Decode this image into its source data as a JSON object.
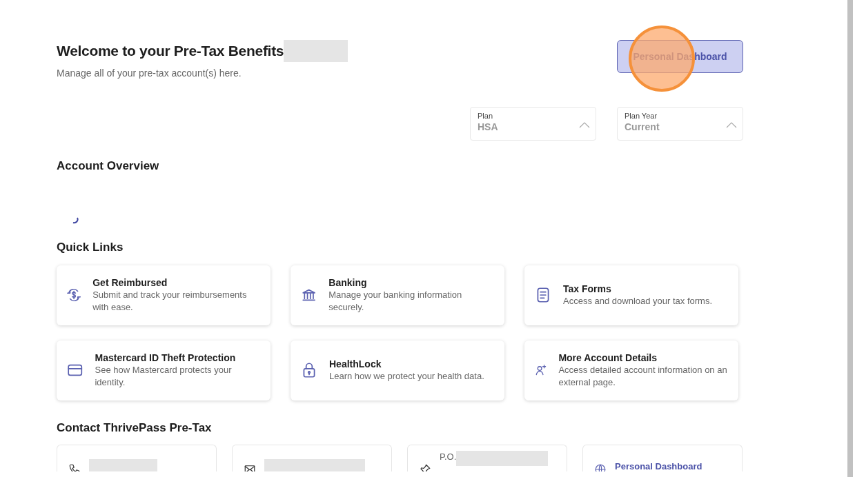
{
  "header": {
    "title": "Welcome to your Pre-Tax Benefits",
    "title_redacted": true,
    "subtitle": "Manage all of your pre-tax account(s) here.",
    "button": "Personal Dashboard",
    "click_marker": true
  },
  "filters": [
    {
      "label": "Plan",
      "value": "HSA",
      "expanded": true
    },
    {
      "label": "Plan Year",
      "value": "Current",
      "expanded": true
    }
  ],
  "account_overview": {
    "title": "Account Overview",
    "loading": true
  },
  "quick_links": {
    "title": "Quick Links",
    "items": [
      {
        "kind": "reimburse",
        "title": "Get Reimbursed",
        "description": "Submit and track your reimbursements with ease."
      },
      {
        "kind": "bank",
        "title": "Banking",
        "description": "Manage your banking information securely."
      },
      {
        "kind": "document",
        "title": "Tax Forms",
        "description": "Access and download your tax forms."
      },
      {
        "kind": "card",
        "title": "Mastercard ID Theft Protection",
        "description": "See how Mastercard protects your identity."
      },
      {
        "kind": "lock",
        "title": "HealthLock",
        "description": "Learn how we protect your health data."
      },
      {
        "kind": "user-plus",
        "title": "More Account Details",
        "description": "Access detailed account information on an external page."
      }
    ]
  },
  "contact": {
    "title": "Contact ThrivePass Pre-Tax",
    "items": [
      {
        "kind": "phone",
        "redacted": true
      },
      {
        "kind": "mail",
        "redacted": true
      },
      {
        "kind": "pin",
        "text": "P.O.",
        "redacted": true
      },
      {
        "kind": "globe",
        "link": "Personal Dashboard"
      }
    ]
  }
}
